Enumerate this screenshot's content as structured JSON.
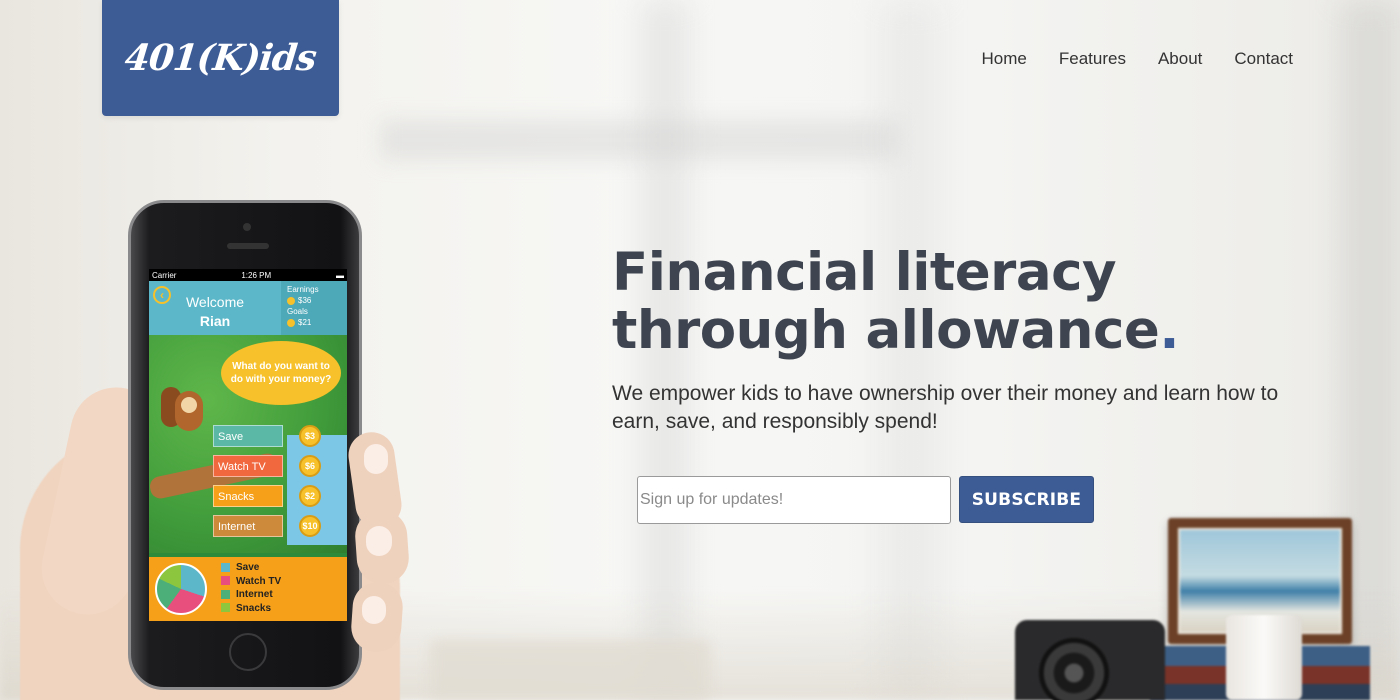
{
  "logo": {
    "text": "401(K)ids"
  },
  "nav": {
    "items": [
      "Home",
      "Features",
      "About",
      "Contact"
    ]
  },
  "hero": {
    "title_line1": "Financial literacy",
    "title_line2": "through allowance",
    "title_dot": ".",
    "subtitle": "We empower kids to have ownership over their money and learn how to earn, save, and responsibly spend!"
  },
  "signup": {
    "placeholder": "Sign up for updates!",
    "value": "",
    "button_label": "SUBSCRIBE"
  },
  "phone_app": {
    "status": {
      "carrier": "Carrier",
      "time": "1:26 PM"
    },
    "back_icon": "chevron-left-icon",
    "welcome_line1": "Welcome",
    "welcome_line2": "Rian",
    "earnings_label": "Earnings",
    "earnings_value": "$36",
    "goals_label": "Goals",
    "goals_value": "$21",
    "prompt": "What do you want to do with your money?",
    "options": [
      {
        "label": "Save",
        "amount": "$3"
      },
      {
        "label": "Watch TV",
        "amount": "$6"
      },
      {
        "label": "Snacks",
        "amount": "$2"
      },
      {
        "label": "Internet",
        "amount": "$10"
      }
    ],
    "legend": [
      "Save",
      "Watch TV",
      "Internet",
      "Snacks"
    ]
  },
  "colors": {
    "brand": "#3d5c96",
    "title": "#3e4450",
    "app_teal": "#5cb8c9",
    "app_orange": "#f6a01a",
    "legend_colors": [
      "#5cb8c9",
      "#e84f7c",
      "#4caf7a",
      "#8cc63f"
    ]
  }
}
